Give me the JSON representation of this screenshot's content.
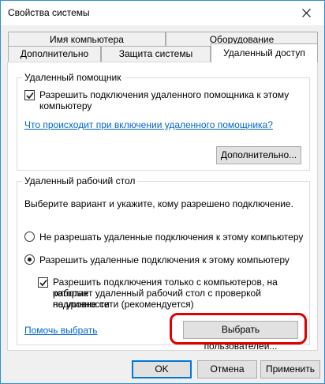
{
  "window": {
    "title": "Свойства системы",
    "close_icon": "close-icon"
  },
  "tabs": {
    "row1": [
      "Имя компьютера",
      "Оборудование"
    ],
    "row2": [
      "Дополнительно",
      "Защита системы",
      "Удаленный доступ"
    ],
    "active": "Удаленный доступ"
  },
  "assistance": {
    "group_title": "Удаленный помощник",
    "allow_checkbox_label_line1": "Разрешить подключения удаленного помощника к этому",
    "allow_checkbox_label_line2": "компьютеру",
    "allow_checked": true,
    "help_link": "Что происходит при включении удаленного помощника?",
    "advanced_button": "Дополнительно..."
  },
  "desktop": {
    "group_title": "Удаленный рабочий стол",
    "instructions": "Выберите вариант и укажите, кому разрешено подключение.",
    "option_deny": "Не разрешать удаленные подключения к этому компьютеру",
    "option_allow": "Разрешить удаленные подключения к этому компьютеру",
    "selected_option": "allow",
    "nla_label_line1": "Разрешить подключения только с компьютеров, на которых",
    "nla_label_line2": "работает удаленный рабочий стол с проверкой подлинности",
    "nla_label_line3": "на уровне сети (рекомендуется)",
    "nla_checked": true,
    "help_link": "Помочь выбрать",
    "select_users_button": "Выбрать пользователей..."
  },
  "footer": {
    "ok": "OK",
    "cancel": "Отмена",
    "apply": "Применить"
  },
  "colors": {
    "highlight": "#e00000",
    "link": "#0066cc",
    "accent": "#0078d7"
  }
}
